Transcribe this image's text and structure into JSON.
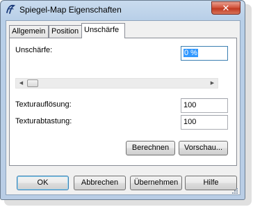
{
  "window": {
    "title": "Spiegel-Map Eigenschaften",
    "close_symbol": "✕"
  },
  "tabs": [
    {
      "label": "Allgemein",
      "active": false
    },
    {
      "label": "Position",
      "active": false
    },
    {
      "label": "Unschärfe",
      "active": true
    }
  ],
  "panel": {
    "blur": {
      "label": "Unschärfe:",
      "value": "0 %",
      "scroll_left": "◀",
      "scroll_right": "▶",
      "slider_fraction": 0.0
    },
    "texture_resolution": {
      "label": "Texturauflösung:",
      "value": "100"
    },
    "texture_sampling": {
      "label": "Texturabtastung:",
      "value": "100"
    },
    "calculate_label": "Berechnen",
    "preview_label": "Vorschau..."
  },
  "footer": {
    "ok_label": "OK",
    "cancel_label": "Abbrechen",
    "apply_label": "Übernehmen",
    "help_label": "Hilfe"
  },
  "icons": {
    "app": "app-logo-icon",
    "close": "close-icon",
    "resize": "resize-grip-icon"
  }
}
